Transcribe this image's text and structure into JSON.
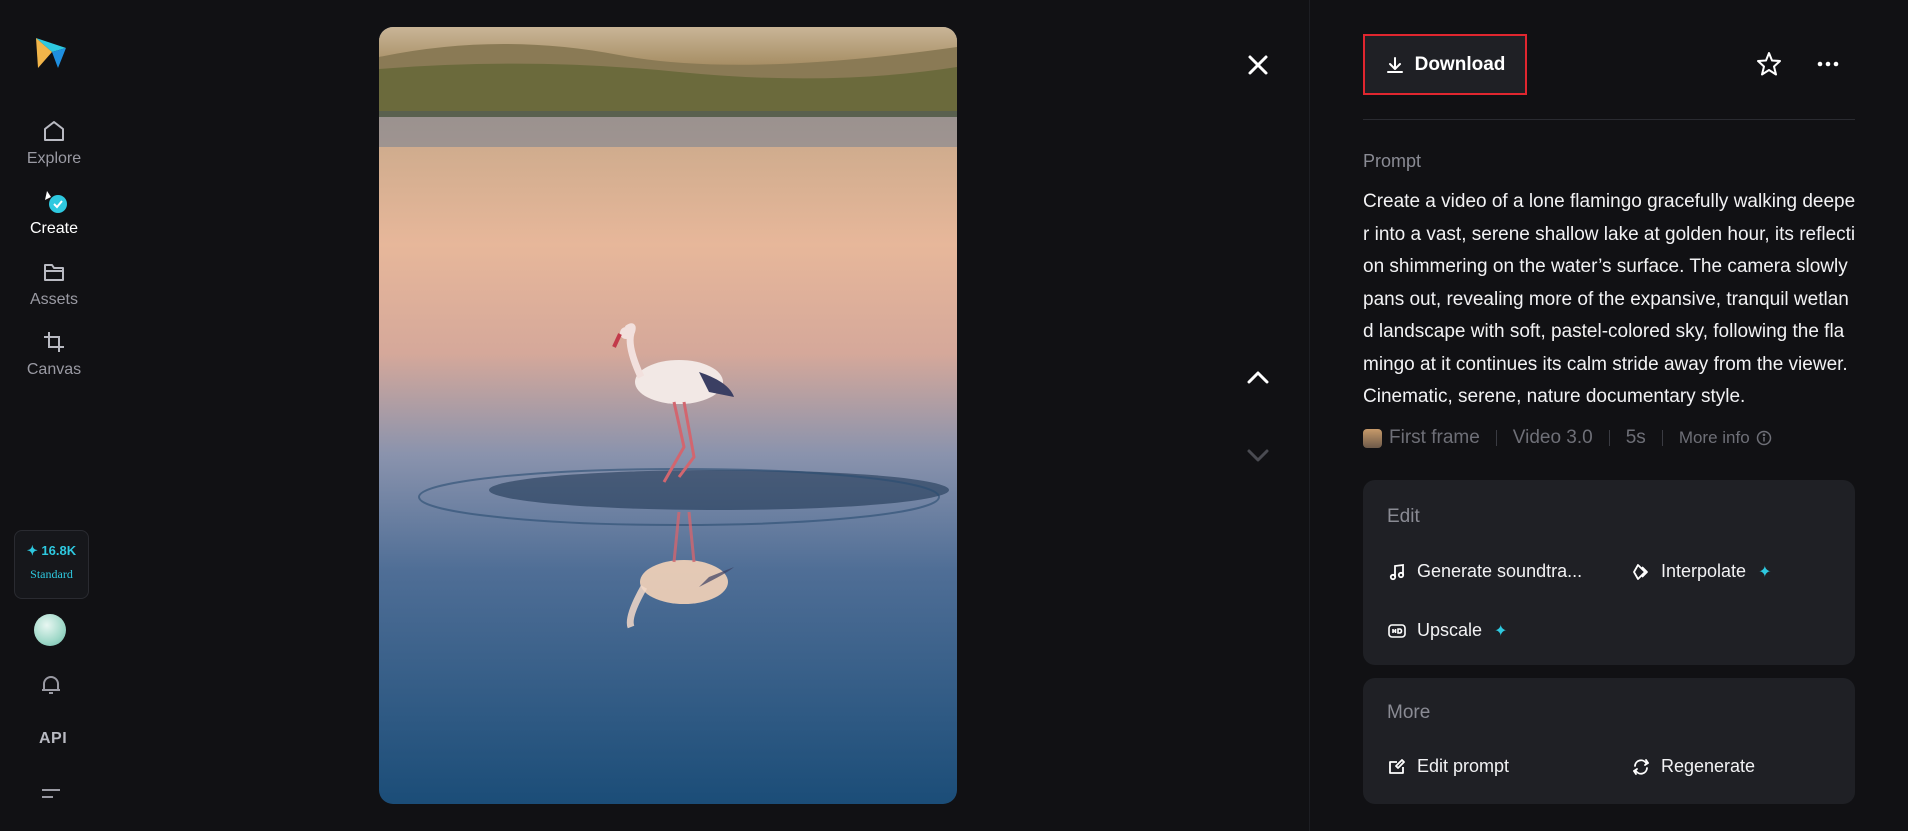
{
  "sidebar": {
    "items": [
      {
        "label": "Explore",
        "icon": "home-icon"
      },
      {
        "label": "Create",
        "icon": "create-icon"
      },
      {
        "label": "Assets",
        "icon": "folder-icon"
      },
      {
        "label": "Canvas",
        "icon": "crop-icon"
      }
    ],
    "credits": {
      "amount": "✦ 16.8K",
      "tier": "Standard"
    },
    "api_label": "API"
  },
  "toolbar": {
    "download_label": "Download"
  },
  "prompt": {
    "title": "Prompt",
    "text": "Create a video of a lone flamingo gracefully walking deeper into a vast, serene shallow lake at golden hour, its reflection shimmering on the water’s surface. The camera slowly pans out, revealing more of the expansive, tranquil wetland landscape with soft, pastel-colored sky, following the flamingo at it continues its calm stride away from the viewer. Cinematic, serene, nature documentary style."
  },
  "meta": {
    "first_frame": "First frame",
    "model": "Video 3.0",
    "duration": "5s",
    "more_info": "More info"
  },
  "edit_card": {
    "title": "Edit",
    "actions": [
      {
        "label": "Generate soundtra...",
        "icon": "music-note-icon"
      },
      {
        "label": "Interpolate",
        "icon": "interpolate-icon",
        "premium": true
      },
      {
        "label": "Upscale",
        "icon": "hd-icon",
        "premium": true
      }
    ]
  },
  "more_card": {
    "title": "More",
    "actions": [
      {
        "label": "Edit prompt",
        "icon": "edit-prompt-icon"
      },
      {
        "label": "Regenerate",
        "icon": "regenerate-icon"
      }
    ]
  },
  "colors": {
    "accent": "#2ec9e0",
    "highlight": "#e0262f",
    "background": "#111114",
    "card": "#1f2025"
  }
}
